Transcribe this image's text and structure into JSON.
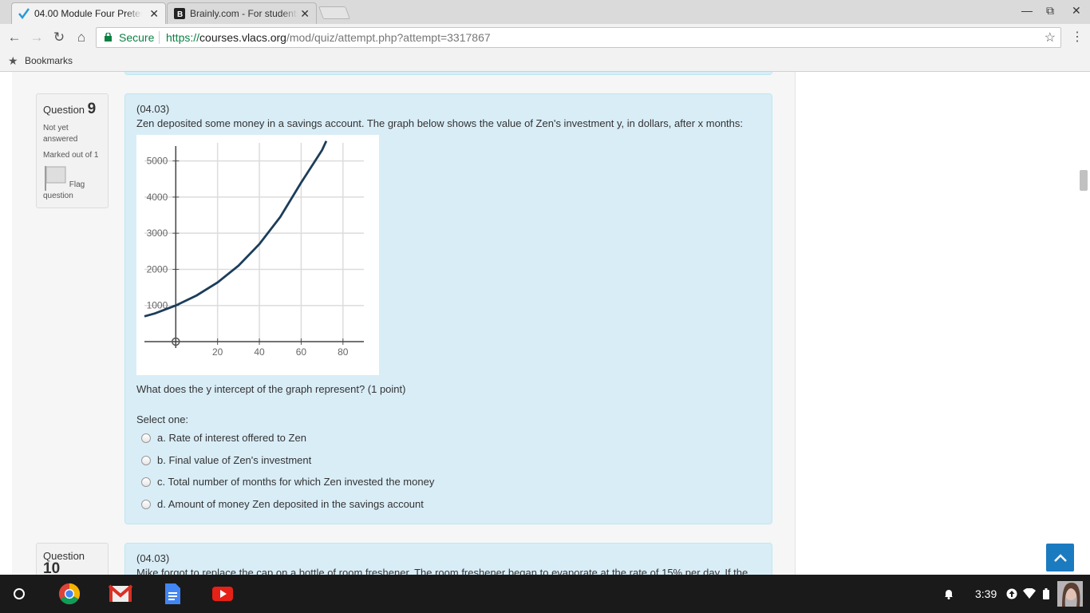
{
  "browser": {
    "tabs": [
      {
        "title": "04.00 Module Four Pretest",
        "active": true,
        "close": "✕"
      },
      {
        "title": "Brainly.com - For students",
        "active": false,
        "close": "✕"
      }
    ],
    "window_controls": {
      "minimize": "—",
      "restore": "⧉",
      "close": "✕"
    },
    "nav": {
      "back": "←",
      "forward": "→",
      "reload": "↻",
      "home": "⌂"
    },
    "secure_label": "Secure",
    "url_scheme": "https://",
    "url_host": "courses.vlacs.org",
    "url_path": "/mod/quiz/attempt.php?attempt=3317867",
    "bookmark_star": "☆",
    "menu": "⋮",
    "bookmarks_label": "Bookmarks",
    "bookmarks_icon": "★"
  },
  "question9": {
    "label": "Question",
    "number": "9",
    "status": "Not yet answered",
    "marks": "Marked out of 1",
    "flag_label": "Flag question",
    "code": "(04.03)",
    "prompt": "Zen deposited some money in a savings account. The graph below shows the value of Zen's investment y, in dollars, after x months:",
    "question": "What does the y intercept of the graph represent? (1 point)",
    "select_label": "Select one:",
    "options": [
      "a. Rate of interest offered to Zen",
      "b. Final value of Zen's investment",
      "c. Total number of months for which Zen invested the money",
      "d. Amount of money Zen deposited in the savings account"
    ]
  },
  "question10": {
    "label": "Question",
    "number": "10",
    "code": "(04.03)",
    "prompt": "Mike forgot to replace the cap on a bottle of room freshener. The room freshener began to evaporate at the rate of 15% per day. If the"
  },
  "chart_data": {
    "type": "line",
    "title": "",
    "xlabel": "",
    "ylabel": "",
    "x_ticks": [
      "20",
      "40",
      "60",
      "80"
    ],
    "y_ticks": [
      "1000",
      "2000",
      "3000",
      "4000",
      "5000"
    ],
    "xlim": [
      -15,
      90
    ],
    "ylim": [
      0,
      5500
    ],
    "grid": true,
    "series": [
      {
        "color": "#1c3d5a",
        "x": [
          -15,
          -10,
          0,
          10,
          20,
          30,
          40,
          50,
          60,
          70,
          72
        ],
        "y": [
          700,
          780,
          1000,
          1280,
          1640,
          2100,
          2700,
          3450,
          4400,
          5300,
          5550
        ]
      }
    ]
  },
  "shelf": {
    "time": "3:39"
  }
}
